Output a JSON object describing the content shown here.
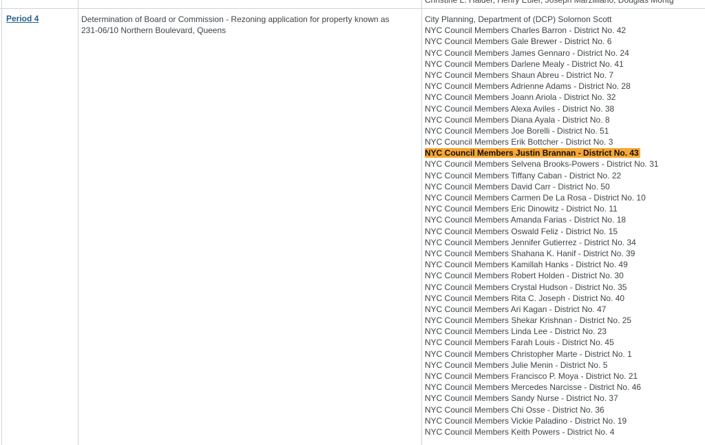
{
  "previous_row": {
    "contacts_cut": "Christine L. Halder, Henry Euler, Joseph Marzilliano, Douglas Montg"
  },
  "row": {
    "period_label": "Period 4",
    "description": "Determination of Board or Commission - Rezoning application for property known as 231-06/10 Northern Boulevard, Queens",
    "highlight_color": "#f7a733",
    "link_color": "#245f8f",
    "contacts": [
      {
        "text": "City Planning, Department of (DCP)  Solomon Scott",
        "highlighted": false
      },
      {
        "text": "NYC Council Members Charles Barron - District No. 42",
        "highlighted": false
      },
      {
        "text": "NYC Council Members Gale Brewer - District No. 6",
        "highlighted": false
      },
      {
        "text": "NYC Council Members James Gennaro - District No. 24",
        "highlighted": false
      },
      {
        "text": "NYC Council Members Darlene Mealy - District No. 41",
        "highlighted": false
      },
      {
        "text": "NYC Council Members Shaun Abreu - District No. 7",
        "highlighted": false
      },
      {
        "text": "NYC Council Members Adrienne Adams - District No. 28",
        "highlighted": false
      },
      {
        "text": "NYC Council Members Joann Ariola - District No. 32",
        "highlighted": false
      },
      {
        "text": "NYC Council Members Alexa Aviles - District No. 38",
        "highlighted": false
      },
      {
        "text": "NYC Council Members Diana Ayala - District No. 8",
        "highlighted": false
      },
      {
        "text": "NYC Council Members Joe Borelli - District No. 51",
        "highlighted": false
      },
      {
        "text": "NYC Council Members Erik Bottcher - District No. 3",
        "highlighted": false
      },
      {
        "text": "NYC Council Members Justin Brannan - District No. 43",
        "highlighted": true
      },
      {
        "text": "NYC Council Members Selvena Brooks-Powers - District No. 31",
        "highlighted": false
      },
      {
        "text": "NYC Council Members Tiffany Caban - District No. 22",
        "highlighted": false
      },
      {
        "text": "NYC Council Members David Carr - District No. 50",
        "highlighted": false
      },
      {
        "text": "NYC Council Members Carmen De La Rosa - District No. 10",
        "highlighted": false
      },
      {
        "text": "NYC Council Members Eric Dinowitz - District No. 11",
        "highlighted": false
      },
      {
        "text": "NYC Council Members Amanda Farias - District No. 18",
        "highlighted": false
      },
      {
        "text": "NYC Council Members Oswald Feliz - District No. 15",
        "highlighted": false
      },
      {
        "text": "NYC Council Members Jennifer Gutierrez - District No. 34",
        "highlighted": false
      },
      {
        "text": "NYC Council Members Shahana K. Hanif - District No. 39",
        "highlighted": false
      },
      {
        "text": "NYC Council Members Kamillah Hanks - District No. 49",
        "highlighted": false
      },
      {
        "text": "NYC Council Members Robert Holden - District No. 30",
        "highlighted": false
      },
      {
        "text": "NYC Council Members Crystal Hudson - District No. 35",
        "highlighted": false
      },
      {
        "text": "NYC Council Members Rita C. Joseph - District No. 40",
        "highlighted": false
      },
      {
        "text": "NYC Council Members Ari Kagan - District No. 47",
        "highlighted": false
      },
      {
        "text": "NYC Council Members Shekar Krishnan - District No. 25",
        "highlighted": false
      },
      {
        "text": "NYC Council Members Linda Lee - District No. 23",
        "highlighted": false
      },
      {
        "text": "NYC Council Members Farah Louis - District No. 45",
        "highlighted": false
      },
      {
        "text": "NYC Council Members Christopher Marte - District No. 1",
        "highlighted": false
      },
      {
        "text": "NYC Council Members Julie Menin - District No. 5",
        "highlighted": false
      },
      {
        "text": "NYC Council Members Francisco P. Moya - District No. 21",
        "highlighted": false
      },
      {
        "text": "NYC Council Members Mercedes Narcisse - District No. 46",
        "highlighted": false
      },
      {
        "text": "NYC Council Members Sandy Nurse - District No. 37",
        "highlighted": false
      },
      {
        "text": "NYC Council Members Chi Osse - District No. 36",
        "highlighted": false
      },
      {
        "text": "NYC Council Members Vickie Paladino - District No. 19",
        "highlighted": false
      },
      {
        "text": "NYC Council Members Keith Powers - District No. 4",
        "highlighted": false
      }
    ]
  }
}
